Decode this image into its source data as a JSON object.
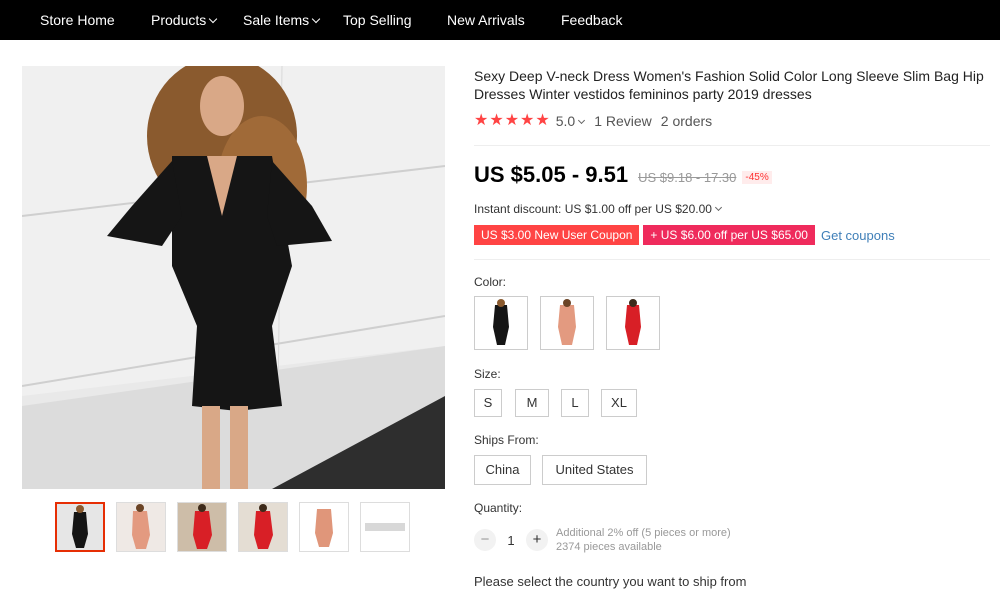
{
  "nav": {
    "items": [
      {
        "label": "Store Home"
      },
      {
        "label": "Products"
      },
      {
        "label": "Sale Items"
      },
      {
        "label": "Top Selling"
      },
      {
        "label": "New Arrivals"
      },
      {
        "label": "Feedback"
      }
    ]
  },
  "product": {
    "title": "Sexy Deep V-neck Dress Women's Fashion Solid Color Long Sleeve Slim Bag Hip Dresses Winter vestidos femininos party 2019 dresses",
    "rating": "5.0",
    "reviews": "1 Review",
    "orders": "2 orders",
    "price": "US $5.05 - 9.51",
    "old_price": "US $9.18 - 17.30",
    "discount": "-45%",
    "instant_discount": "Instant discount: US $1.00 off per US $20.00",
    "coupons": [
      {
        "label": "US $3.00 New User Coupon"
      },
      {
        "label": "+ US $6.00 off per US $65.00"
      }
    ],
    "get_coupons": "Get coupons",
    "color_label": "Color:",
    "size_label": "Size:",
    "sizes": [
      "S",
      "M",
      "L",
      "XL"
    ],
    "ships_from_label": "Ships From:",
    "ships_from": [
      "China",
      "United States"
    ],
    "quantity_label": "Quantity:",
    "quantity": "1",
    "qty_minus": "−",
    "qty_plus": "+",
    "additional_off": "Additional 2% off (5 pieces or more)",
    "available": "2374 pieces available",
    "ship_country": "Please select the country you want to ship from"
  },
  "colors": {
    "accent": "#f44444",
    "nav_bg": "#000000",
    "link": "#3f7fb8"
  }
}
